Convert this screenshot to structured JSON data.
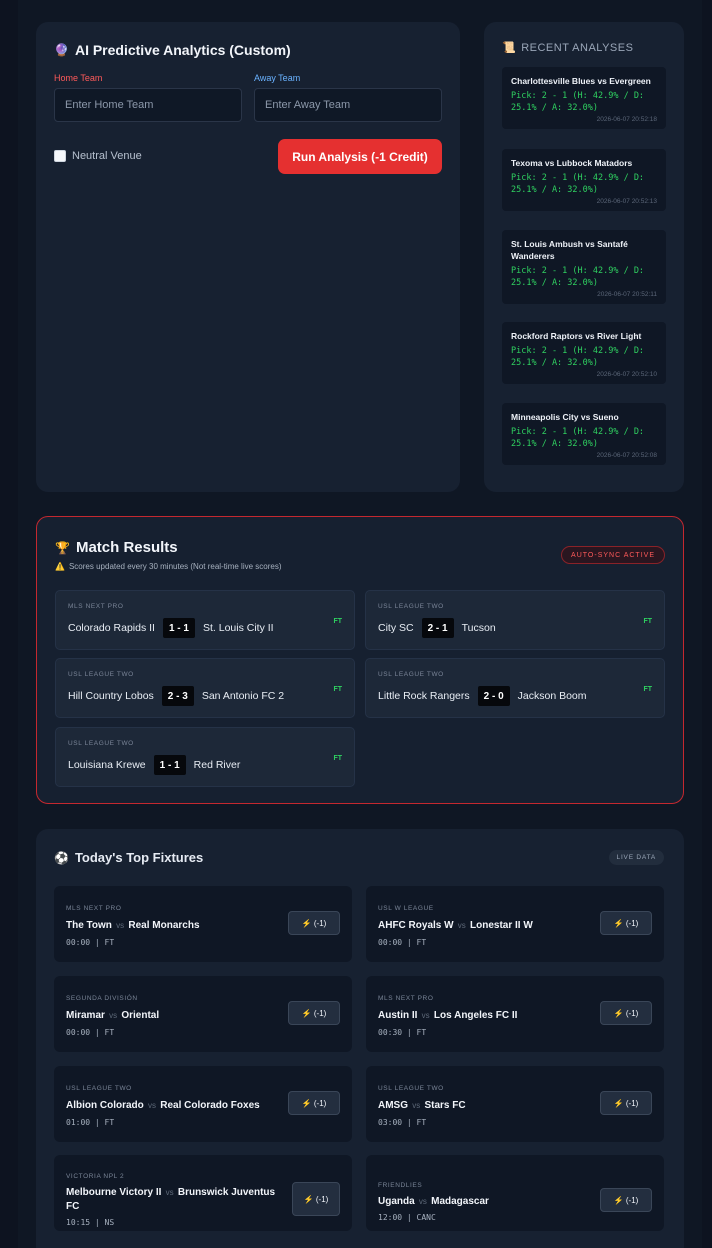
{
  "predictor": {
    "title": "AI Predictive Analytics (Custom)",
    "home_label": "Home Team",
    "away_label": "Away Team",
    "home_placeholder": "Enter Home Team",
    "away_placeholder": "Enter Away Team",
    "neutral_label": "Neutral Venue",
    "run_label": "Run Analysis (-1 Credit)"
  },
  "recent": {
    "title": "RECENT ANALYSES",
    "items": [
      {
        "name": "Charlottesville Blues vs Evergreen",
        "pick": "Pick: 2 - 1 (H: 42.9% / D: 25.1% / A: 32.0%)",
        "time": "2026-06-07 20:52:18"
      },
      {
        "name": "Texoma vs Lubbock Matadors",
        "pick": "Pick: 2 - 1 (H: 42.9% / D: 25.1% / A: 32.0%)",
        "time": "2026-06-07 20:52:13"
      },
      {
        "name": "St. Louis Ambush vs Santafé Wanderers",
        "pick": "Pick: 2 - 1 (H: 42.9% / D: 25.1% / A: 32.0%)",
        "time": "2026-06-07 20:52:11"
      },
      {
        "name": "Rockford Raptors vs River Light",
        "pick": "Pick: 2 - 1 (H: 42.9% / D: 25.1% / A: 32.0%)",
        "time": "2026-06-07 20:52:10"
      },
      {
        "name": "Minneapolis City vs Sueno",
        "pick": "Pick: 2 - 1 (H: 42.9% / D: 25.1% / A: 32.0%)",
        "time": "2026-06-07 20:52:08"
      }
    ]
  },
  "results": {
    "title": "Match Results",
    "subtitle": "Scores updated every 30 minutes (Not real-time live scores)",
    "badge": "AUTO-SYNC ACTIVE",
    "matches": [
      {
        "league": "MLS NEXT PRO",
        "home": "Colorado Rapids II",
        "score": "1 - 1",
        "away": "St. Louis City II",
        "status": "FT"
      },
      {
        "league": "USL LEAGUE TWO",
        "home": "City SC",
        "score": "2 - 1",
        "away": "Tucson",
        "status": "FT"
      },
      {
        "league": "USL LEAGUE TWO",
        "home": "Hill Country Lobos",
        "score": "2 - 3",
        "away": "San Antonio FC 2",
        "status": "FT"
      },
      {
        "league": "USL LEAGUE TWO",
        "home": "Little Rock Rangers",
        "score": "2 - 0",
        "away": "Jackson Boom",
        "status": "FT"
      },
      {
        "league": "USL LEAGUE TWO",
        "home": "Louisiana Krewe",
        "score": "1 - 1",
        "away": "Red River",
        "status": "FT"
      }
    ]
  },
  "fixtures": {
    "title": "Today's Top Fixtures",
    "badge": "LIVE DATA",
    "vs": "vs",
    "button": "⚡ (-1)",
    "items": [
      {
        "league": "MLS NEXT PRO",
        "home": "The Town",
        "away": "Real Monarchs",
        "time": "00:00",
        "status": "FT"
      },
      {
        "league": "USL W LEAGUE",
        "home": "AHFC Royals W",
        "away": "Lonestar II W",
        "time": "00:00",
        "status": "FT"
      },
      {
        "league": "SEGUNDA DIVISIÓN",
        "home": "Miramar",
        "away": "Oriental",
        "time": "00:00",
        "status": "FT"
      },
      {
        "league": "MLS NEXT PRO",
        "home": "Austin II",
        "away": "Los Angeles FC II",
        "time": "00:30",
        "status": "FT"
      },
      {
        "league": "USL LEAGUE TWO",
        "home": "Albion Colorado",
        "away": "Real Colorado Foxes",
        "time": "01:00",
        "status": "FT"
      },
      {
        "league": "USL LEAGUE TWO",
        "home": "AMSG",
        "away": "Stars FC",
        "time": "03:00",
        "status": "FT"
      },
      {
        "league": "VICTORIA NPL 2",
        "home": "Melbourne Victory II",
        "away": "Brunswick Juventus FC",
        "time": "10:15",
        "status": "NS"
      },
      {
        "league": "FRIENDLIES",
        "home": "Uganda",
        "away": "Madagascar",
        "time": "12:00",
        "status": "CANC"
      }
    ]
  }
}
